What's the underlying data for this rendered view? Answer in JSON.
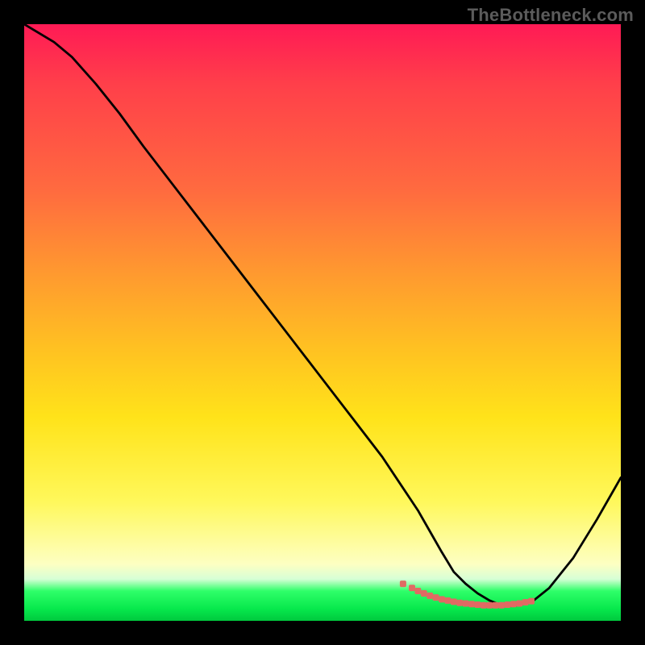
{
  "watermark": "TheBottleneck.com",
  "chart_data": {
    "type": "line",
    "title": "",
    "xlabel": "",
    "ylabel": "",
    "xlim": [
      0,
      100
    ],
    "ylim": [
      0,
      100
    ],
    "grid": false,
    "legend": false,
    "series": [
      {
        "name": "main-curve",
        "color": "#000000",
        "x": [
          0,
          5,
          8,
          12,
          16,
          20,
          25,
          30,
          35,
          40,
          45,
          50,
          55,
          60,
          63,
          66,
          68,
          70,
          72,
          74,
          76,
          78,
          80,
          82,
          85,
          88,
          92,
          96,
          100
        ],
        "y": [
          100,
          97,
          94.5,
          90,
          85,
          79.5,
          73,
          66.5,
          60,
          53.5,
          47,
          40.5,
          34,
          27.5,
          23,
          18.5,
          15,
          11.5,
          8.2,
          6.2,
          4.6,
          3.4,
          2.6,
          2.5,
          3.1,
          5.5,
          10.5,
          17,
          24
        ]
      },
      {
        "name": "marker-band",
        "color": "#e06a63",
        "type": "scatter",
        "x": [
          63.5,
          65,
          66,
          67,
          68,
          69,
          70,
          71,
          72,
          73,
          74,
          75,
          76,
          77,
          78,
          79,
          80,
          81,
          82,
          83,
          84,
          85
        ],
        "y": [
          6.2,
          5.5,
          5.0,
          4.6,
          4.2,
          3.9,
          3.6,
          3.4,
          3.2,
          3.0,
          2.9,
          2.8,
          2.7,
          2.6,
          2.6,
          2.6,
          2.6,
          2.7,
          2.8,
          2.9,
          3.1,
          3.3
        ]
      }
    ],
    "background_gradient": {
      "direction": "vertical",
      "stops": [
        {
          "pos": 0.0,
          "color": "#ff1a55"
        },
        {
          "pos": 0.28,
          "color": "#ff6b3f"
        },
        {
          "pos": 0.55,
          "color": "#ffc321"
        },
        {
          "pos": 0.8,
          "color": "#fff85b"
        },
        {
          "pos": 0.93,
          "color": "#d7ffd6"
        },
        {
          "pos": 0.97,
          "color": "#07e84c"
        },
        {
          "pos": 1.0,
          "color": "#00c93e"
        }
      ]
    }
  }
}
